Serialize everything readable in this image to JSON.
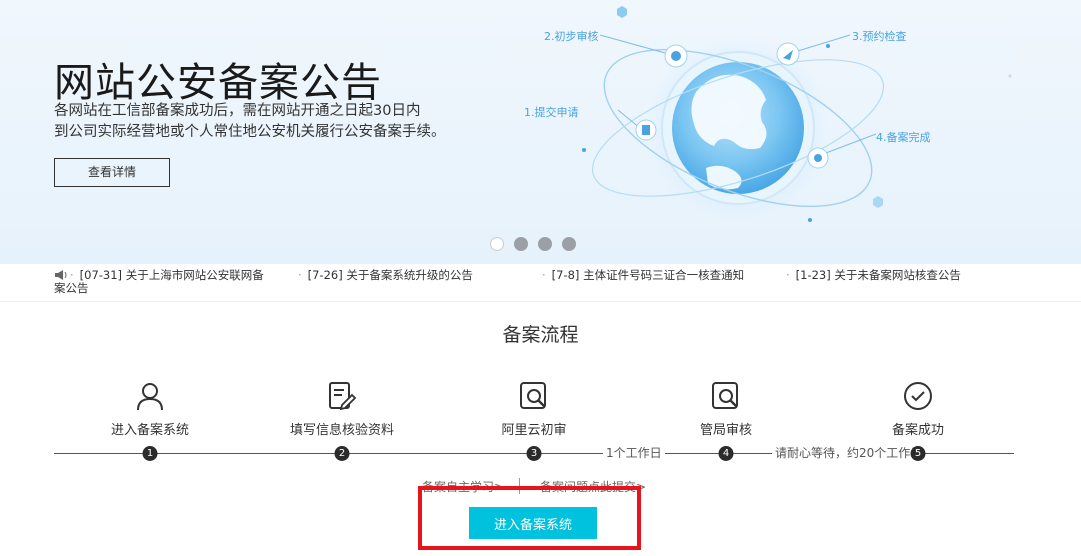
{
  "banner": {
    "title": "网站公安备案公告",
    "desc_line1": "各网站在工信部备案成功后，需在网站开通之日起30日内",
    "desc_line2": "到公司实际经营地或个人常住地公安机关履行公安备案手续。",
    "button_label": "查看详情",
    "flow_labels": [
      "1.提交申请",
      "2.初步审核",
      "3.预约检查",
      "4.备案完成"
    ],
    "slide_count": 4,
    "active_slide": 1
  },
  "notices": [
    {
      "line1": "[07-31] 关于上海市网站公安联网备",
      "line2": "案公告"
    },
    {
      "line1": "[7-26] 关于备案系统升级的公告",
      "line2": ""
    },
    {
      "line1": "[7-8] 主体证件号码三证合一核查通知",
      "line2": ""
    },
    {
      "line1": "[1-23] 关于未备案网站核查公告",
      "line2": ""
    }
  ],
  "process": {
    "title": "备案流程",
    "steps": [
      {
        "label": "进入备案系统",
        "num": "1",
        "icon": "user-icon"
      },
      {
        "label": "填写信息核验资料",
        "num": "2",
        "icon": "edit-form-icon"
      },
      {
        "label": "阿里云初审",
        "num": "3",
        "icon": "search-doc-icon"
      },
      {
        "label": "管局审核",
        "num": "4",
        "icon": "search-doc-icon"
      },
      {
        "label": "备案成功",
        "num": "5",
        "icon": "check-circle-icon"
      }
    ],
    "durations": [
      "1个工作日",
      "请耐心等待，约20个工作日"
    ],
    "links": [
      "备案自主学习>",
      "备案问题点此提交>"
    ],
    "cta_label": "进入备案系统"
  },
  "colors": {
    "accent": "#00c1de",
    "highlight": "#e8141c",
    "globe": "#4aa3df"
  }
}
